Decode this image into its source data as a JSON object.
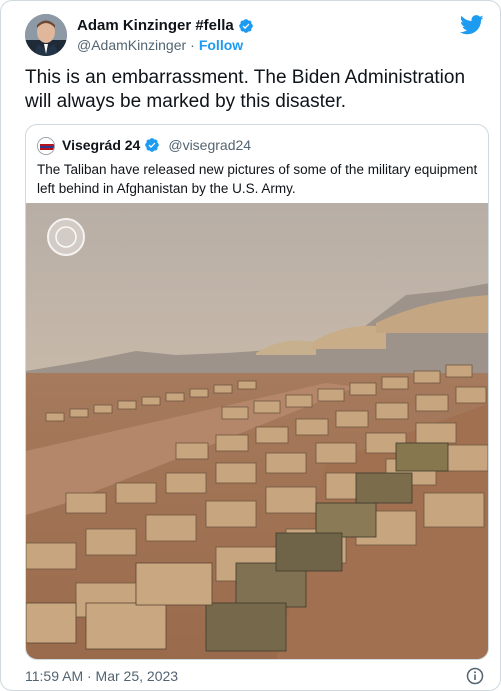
{
  "author": {
    "name": "Adam Kinzinger #fella",
    "handle": "@AdamKinzinger",
    "separator": "·",
    "follow_label": "Follow"
  },
  "tweet": {
    "text": "This is an embarrassment. The Biden Administration will always be marked by this disaster."
  },
  "quoted": {
    "name": "Visegrád 24",
    "handle": "@visegrad24",
    "text": "The Taliban have released new pictures of some of the military equipment left behind in Afghanistan by the U.S. Army.",
    "image_description": "rows-of-military-vehicles"
  },
  "footer": {
    "timestamp": "11:59 AM · Mar 25, 2023"
  },
  "icons": {
    "verified": "verified-badge-icon",
    "twitter": "twitter-bird-icon",
    "info": "info-icon"
  },
  "colors": {
    "accent": "#1d9bf0",
    "secondary_text": "#536471",
    "border": "#cfd9de"
  }
}
